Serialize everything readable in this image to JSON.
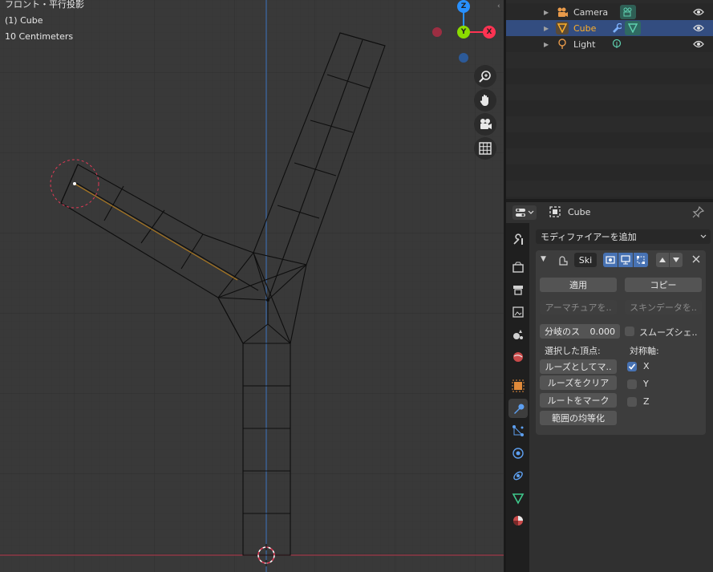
{
  "viewport": {
    "view_name": "フロント・平行投影",
    "object_label": "(1) Cube",
    "scale_label": "10 Centimeters",
    "gizmo": {
      "z": "Z",
      "y": "Y",
      "x": "X"
    },
    "colors": {
      "x_axis": "#ff3352",
      "y_axis": "#8bdc00",
      "z_axis": "#2890ff",
      "grid_bg": "#393939"
    }
  },
  "outliner": {
    "items": [
      {
        "label": "Camera",
        "icon": "camera-icon",
        "data_icon": "camera-data-icon"
      },
      {
        "label": "Cube",
        "icon": "mesh-object-icon",
        "modifier_icon": "wrench-icon",
        "data_icon": "mesh-data-icon",
        "selected": true
      },
      {
        "label": "Light",
        "icon": "light-icon",
        "data_icon": "light-data-icon"
      }
    ]
  },
  "properties": {
    "object_name": "Cube",
    "add_modifier": "モディファイアーを追加",
    "modifier": {
      "name": "Ski",
      "apply": "適用",
      "copy": "コピー",
      "create_armature": "アーマチュアを..",
      "create_skin_data": "スキンデータを..",
      "branch_smoothing_label": "分岐のス",
      "branch_smoothing_value": "0.000",
      "smooth_shading": "スムーズシェ..",
      "selected_vertices": "選択した頂点:",
      "symmetry_axes": "対称軸:",
      "mark_loose": "ルーズとしてマ..",
      "clear_loose": "ルーズをクリア",
      "mark_root": "ルートをマーク",
      "equalize_radii": "範囲の均等化",
      "axis_x": "X",
      "axis_y": "Y",
      "axis_z": "Z",
      "axis_x_checked": true,
      "axis_y_checked": false,
      "axis_z_checked": false
    }
  }
}
